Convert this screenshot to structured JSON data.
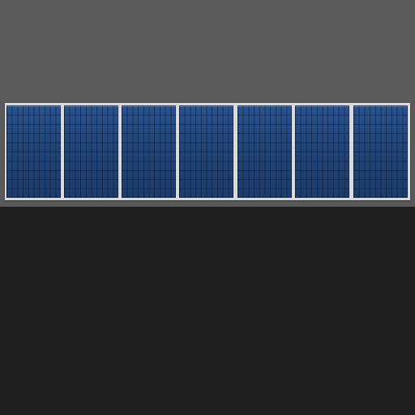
{
  "scene": {
    "subject": "solar-panel-array",
    "panel_count": 7,
    "colors": {
      "background_upper": "#5a5a5a",
      "background_lower": "#1e1e1e",
      "frame": "#d9dadc",
      "cell_blue": "#234678"
    }
  }
}
